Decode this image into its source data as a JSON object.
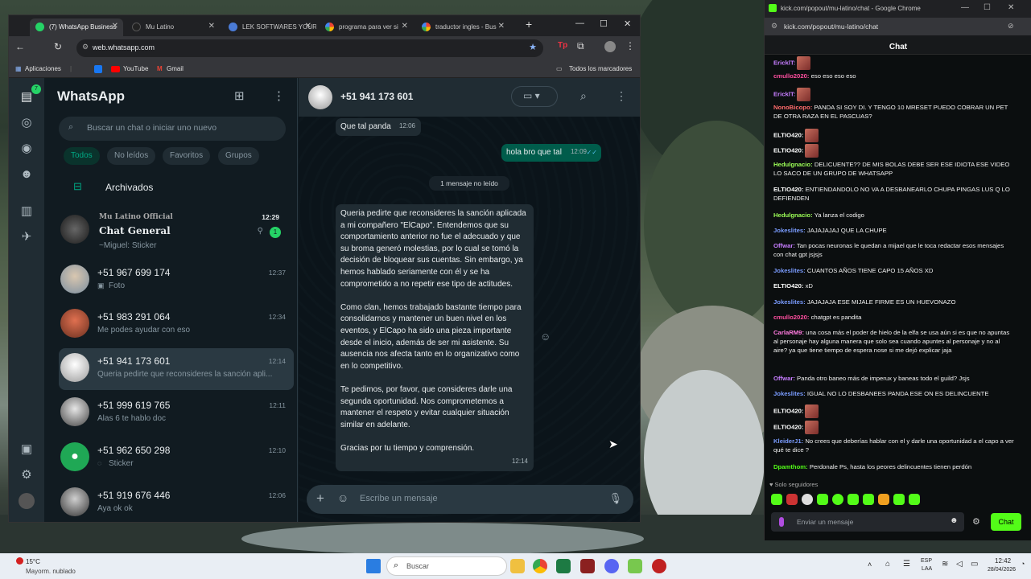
{
  "whatsapp_browser": {
    "tabs": [
      {
        "title": "(7) WhatsApp Business",
        "active": true
      },
      {
        "title": "Mu Latino",
        "active": false
      },
      {
        "title": "LEK SOFTWARES YOUR HI",
        "active": false
      },
      {
        "title": "programa para ver si",
        "active": false
      },
      {
        "title": "traductor ingles - Bus",
        "active": false
      }
    ],
    "url": "web.whatsapp.com",
    "bookmarks": [
      "Aplicaciones",
      "YouTube",
      "Gmail"
    ],
    "bookmarks_folder": "Todos los marcadores"
  },
  "whatsapp": {
    "title": "WhatsApp",
    "rail_badge": "7",
    "search_placeholder": "Buscar un chat o iniciar uno nuevo",
    "filters": [
      "Todos",
      "No leídos",
      "Favoritos",
      "Grupos"
    ],
    "archived_label": "Archivados",
    "chats": [
      {
        "group": "Mu Latino Official",
        "name": "Chat General",
        "preview": "~Miguel: Sticker",
        "time": "12:29",
        "unread": "1"
      },
      {
        "name": "+51 967 699 174",
        "preview": "Foto",
        "time": "12:37"
      },
      {
        "name": "+51 983 291 064",
        "preview": "Me podes ayudar con eso",
        "time": "12:34"
      },
      {
        "name": "+51 941 173 601",
        "preview": "Queria pedirte que reconsideres la sanción apli...",
        "time": "12:14",
        "selected": true
      },
      {
        "name": "+51 999 619 765",
        "preview": "Alas 6 te hablo doc",
        "time": "12:11"
      },
      {
        "name": "+51 962 650 298",
        "preview": "Sticker",
        "time": "12:10"
      },
      {
        "name": "+51 919 676 446",
        "preview": "Aya ok ok",
        "time": "12:06"
      }
    ],
    "conversation": {
      "contact": "+51 941 173 601",
      "msg1": {
        "text": "Que tal panda",
        "time": "12:06"
      },
      "msg2": {
        "text": "hola bro que tal",
        "time": "12:09"
      },
      "unread_divider": "1 mensaje no leído",
      "long_msg": {
        "p1": "Queria pedirte que reconsideres la sanción aplicada a mi compañero \"ElCapo\". Entendemos que su comportamiento anterior no fue el adecuado y que su broma generó molestias, por lo cual se tomó la decisión de bloquear sus cuentas. Sin embargo, ya hemos hablado seriamente con él y se ha comprometido a no repetir ese tipo de actitudes.",
        "p2": "Como clan, hemos trabajado bastante tiempo para consolidarnos y mantener un buen nivel en los eventos, y ElCapo ha sido una pieza importante desde el inicio, además de ser mi asistente. Su ausencia nos afecta tanto en lo organizativo como en lo competitivo.",
        "p3": "Te pedimos, por favor, que consideres darle una segunda oportunidad. Nos comprometemos a mantener el respeto y evitar cualquier situación similar en adelante.",
        "p4": "Gracias por tu tiempo y comprensión.",
        "time": "12:14"
      },
      "composer_placeholder": "Escribe un mensaje"
    }
  },
  "kick": {
    "window_title": "kick.com/popout/mu-latino/chat - Google Chrome",
    "url": "kick.com/popout/mu-latino/chat",
    "header": "Chat",
    "messages": [
      {
        "user": "EricklT:",
        "color": "#c77dff",
        "text": "",
        "emote": true
      },
      {
        "user": "cmullo2020:",
        "color": "#ff4fa0",
        "text": " eso eso eso eso"
      },
      {
        "user": "EricklT:",
        "color": "#c77dff",
        "text": "",
        "emote": true
      },
      {
        "user": "NonoBicopo:",
        "color": "#ff6b6b",
        "text": " PANDA SI SOY DI. Y TENGO 10 MRESET PUEDO COBRAR UN PET DE OTRA RAZA EN EL PASCUAS?"
      },
      {
        "user": "ELTIO420:",
        "color": "#ffffff",
        "text": "",
        "emote": true
      },
      {
        "user": "ELTIO420:",
        "color": "#ffffff",
        "text": "",
        "emote": true
      },
      {
        "user": "Hedulgnacio:",
        "color": "#9cff57",
        "text": " DELICUENTE?? DE MIS BOLAS DEBE SER ESE IDIOTA ESE VIDEO LO SACO DE UN GRUPO DE WHATSAPP"
      },
      {
        "user": "ELTIO420:",
        "color": "#ffffff",
        "text": " ENTIENDANDOLO NO VA A DESBANEARLO CHUPA PINGAS LUS Q LO DEFIENDEN"
      },
      {
        "user": "Hedulgnacio:",
        "color": "#9cff57",
        "text": " Ya lanza el codigo"
      },
      {
        "user": "Jokeslites:",
        "color": "#7a9cff",
        "text": " JAJAJAJAJ QUE LA CHUPE"
      },
      {
        "user": "Offwar:",
        "color": "#c77dff",
        "text": " Tan pocas neuronas le quedan a mijael que le toca redactar esos mensajes con chat gpt jsjsjs"
      },
      {
        "user": "Jokeslites:",
        "color": "#7a9cff",
        "text": " CUANTOS AÑOS TIENE CAPO 15 AÑOS XD"
      },
      {
        "user": "ELTIO420:",
        "color": "#ffffff",
        "text": " xD"
      },
      {
        "user": "Jokeslites:",
        "color": "#7a9cff",
        "text": " JAJAJAJA ESE MIJALE FIRME ES UN HUEVONAZO"
      },
      {
        "user": "cmullo2020:",
        "color": "#ff4fa0",
        "text": " chatgpt es pandita"
      },
      {
        "user": "CarlaRM9:",
        "color": "#ff7adf",
        "text": " una cosa más el poder de hielo de la elfa se usa aún si es que no apuntas al personaje hay alguna manera que solo sea cuando apuntes al personaje y no al aire? ya que tiene tiempo de espera nose si me dejó explicar jaja"
      },
      {
        "user": "Offwar:",
        "color": "#c77dff",
        "text": " Panda otro baneo más de imperux y baneas todo el guild? Jsjs"
      },
      {
        "user": "Jokeslites:",
        "color": "#7a9cff",
        "text": " IGUAL NO LO DESBANEES PANDA ESE ON ES DELINCUENTE"
      },
      {
        "user": "ELTIO420:",
        "color": "#ffffff",
        "text": "",
        "emote": true
      },
      {
        "user": "ELTIO420:",
        "color": "#ffffff",
        "text": "",
        "emote": true
      },
      {
        "user": "KleiderJ1:",
        "color": "#7a9cff",
        "text": " No crees que deberías hablar con el y darle una oportunidad a el capo a ver qué te dice ?"
      },
      {
        "user": "Dpamthom:",
        "color": "#53fc18",
        "text": " Perdonale Ps, hasta los peores delincuentes tienen perdón"
      }
    ],
    "followers_only": "Solo seguidores",
    "input_placeholder": "Enviar un mensaje",
    "send_label": "Chat",
    "accent": "#53fc18"
  },
  "taskbar": {
    "weather_temp": "15°C",
    "weather_desc": "Mayorm. nublado",
    "search_label": "Buscar",
    "lang": "ESP",
    "lang2": "LAA",
    "time": "12:42",
    "date": "28/04/2026"
  }
}
